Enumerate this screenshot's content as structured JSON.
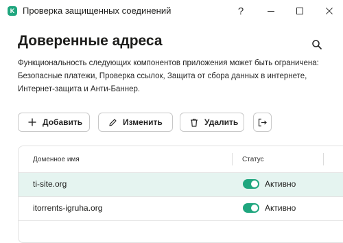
{
  "window": {
    "title": "Проверка защищенных соединений",
    "logo_letter": "K",
    "help_label": "?"
  },
  "page": {
    "title": "Доверенные адреса",
    "description": "Функциональность следующих компонентов приложения может быть ограничена: Безопасные платежи, Проверка ссылок, Защита от сбора данных в интернете, Интернет-защита и Анти-Баннер."
  },
  "toolbar": {
    "add_label": "Добавить",
    "edit_label": "Изменить",
    "delete_label": "Удалить"
  },
  "table": {
    "columns": [
      "Доменное имя",
      "Статус"
    ],
    "rows": [
      {
        "domain": "ti-site.org",
        "status": "Активно",
        "enabled": true,
        "selected": true
      },
      {
        "domain": "itorrents-igruha.org",
        "status": "Активно",
        "enabled": true,
        "selected": false
      }
    ]
  },
  "colors": {
    "accent": "#1fa67e",
    "selected_row": "#e5f4f0"
  },
  "icons": [
    "search-icon",
    "plus-icon",
    "pencil-icon",
    "trash-icon",
    "export-icon",
    "minimize-icon",
    "maximize-icon",
    "close-icon"
  ]
}
